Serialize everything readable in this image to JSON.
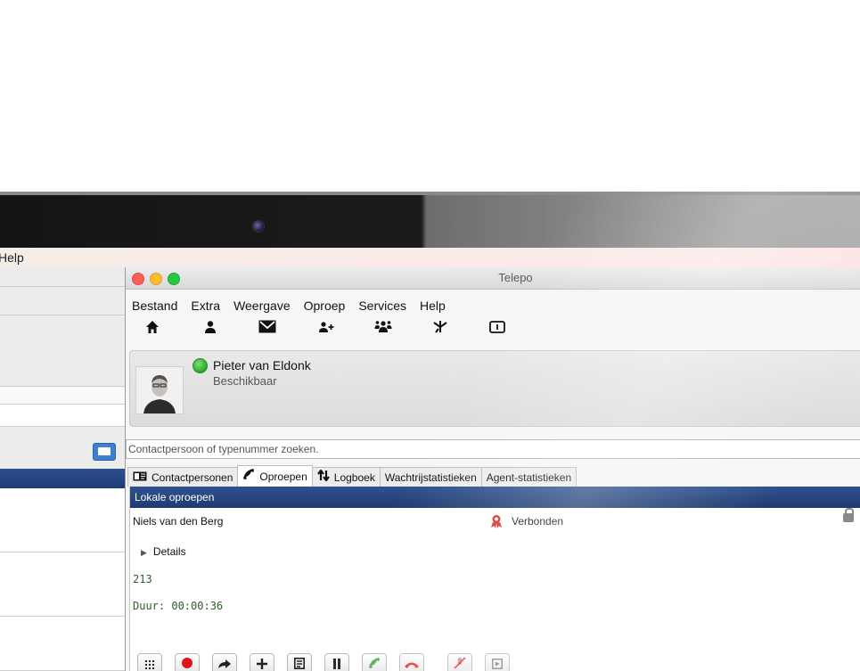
{
  "host": {
    "menubar_item": "Help"
  },
  "app": {
    "title": "Telepo",
    "menu": [
      "Bestand",
      "Extra",
      "Weergave",
      "Oproep",
      "Services",
      "Help"
    ],
    "toolbar_icons": [
      "home-icon",
      "person-icon",
      "mail-icon",
      "add-person-icon",
      "group-icon",
      "transfer-icon",
      "info-box-icon"
    ]
  },
  "profile": {
    "name": "Pieter van Eldonk",
    "status": "Beschikbaar",
    "status_color": "#2aa62a"
  },
  "search": {
    "placeholder": "Contactpersoon of typenummer zoeken."
  },
  "tabs": [
    {
      "label": "Contactpersonen",
      "icon": "contact-card-icon"
    },
    {
      "label": "Oproepen",
      "icon": "phone-icon",
      "active": true
    },
    {
      "label": "Logboek",
      "icon": "log-arrows-icon"
    },
    {
      "label": "Wachtrijstatistieken"
    },
    {
      "label": "Agent-statistieken"
    }
  ],
  "calls": {
    "section_title": "Lokale oproepen",
    "caller": "Niels van den Berg",
    "state": "Verbonden",
    "details_label": "Details",
    "number": "213",
    "duration": "Duur: 00:00:36"
  },
  "call_buttons": [
    "keypad-icon",
    "record-icon",
    "transfer-icon",
    "add-call-icon",
    "notes-icon",
    "pause-icon",
    "answer-icon",
    "hangup-icon",
    "mute-icon",
    "video-icon"
  ],
  "colors": {
    "header_blue": "#1e3b70",
    "record_red": "#e01515",
    "answer_green": "#4caf50",
    "hangup_red": "#e03030"
  }
}
